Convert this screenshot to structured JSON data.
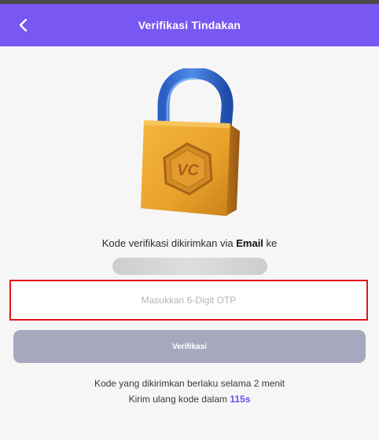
{
  "header": {
    "title": "Verifikasi Tindakan",
    "back_icon": "chevron-left-icon"
  },
  "lock_image": {
    "icon": "padlock-icon",
    "emblem_text": "VC"
  },
  "info": {
    "prefix": "Kode verifikasi dikirimkan via",
    "channel": "Email",
    "suffix": "ke"
  },
  "otp": {
    "placeholder": "Masukkan 6-Digit OTP",
    "value": ""
  },
  "verify_button": {
    "label": "Verifikasi"
  },
  "footer": {
    "validity_text": "Kode yang dikirimkan berlaku selama 2 menit",
    "resend_prefix": "Kirim ulang kode dalam",
    "countdown": "115s"
  },
  "colors": {
    "header_bg": "#7857f2",
    "button_disabled": "#a6a9be",
    "highlight_border": "#e4141b",
    "countdown": "#6b4ff0"
  }
}
